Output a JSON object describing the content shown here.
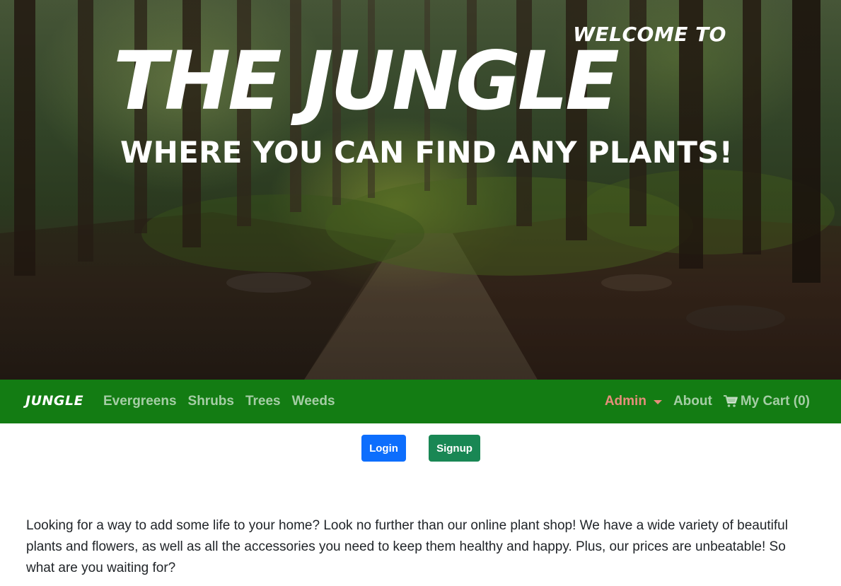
{
  "hero": {
    "welcome": "WELCOME TO",
    "title": "THE JUNGLE",
    "subtitle": "WHERE YOU CAN FIND ANY PLANTS!"
  },
  "navbar": {
    "brand": "JUNGLE",
    "links": [
      "Evergreens",
      "Shrubs",
      "Trees",
      "Weeds"
    ],
    "admin_label": "Admin",
    "about_label": "About",
    "cart_label": "My Cart (0)",
    "cart_icon": "shopping-cart-icon"
  },
  "auth": {
    "login_label": "Login",
    "signup_label": "Signup"
  },
  "intro": {
    "text": "Looking for a way to add some life to your home? Look no further than our online plant shop! We have a wide variety of beautiful plants and flowers, as well as all the accessories you need to keep them healthy and happy. Plus, our prices are unbeatable! So what are you waiting for?"
  },
  "colors": {
    "navbar_bg": "#137c13",
    "admin_link": "#e58e7a",
    "login_button": "#0d6efd",
    "signup_button": "#198754"
  }
}
